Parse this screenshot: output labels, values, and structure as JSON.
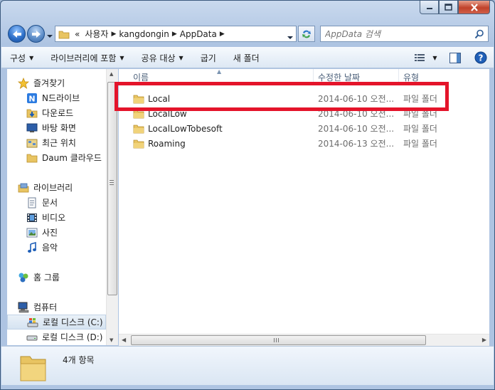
{
  "address": {
    "overflow": "«",
    "segments": [
      "사용자",
      "kangdongin",
      "AppData"
    ]
  },
  "search": {
    "placeholder": "AppData 검색"
  },
  "toolbar": {
    "organize": "구성",
    "include_library": "라이브러리에 포함",
    "share": "공유 대상",
    "burn": "굽기",
    "new_folder": "새 폴더"
  },
  "nav": {
    "favorites": "즐겨찾기",
    "fav_items": [
      "N드라이브",
      "다운로드",
      "바탕 화면",
      "최근 위치",
      "Daum 클라우드"
    ],
    "libraries": "라이브러리",
    "lib_items": [
      "문서",
      "비디오",
      "사진",
      "음악"
    ],
    "homegroup": "홈 그룹",
    "computer": "컴퓨터",
    "drives": [
      "로컬 디스크 (C:)",
      "로컬 디스크 (D:)"
    ]
  },
  "columns": {
    "name": "이름",
    "date": "수정한 날짜",
    "type": "유형"
  },
  "files": [
    {
      "name": "Local",
      "date": "2014-06-10 오전...",
      "type": "파일 폴더"
    },
    {
      "name": "LocalLow",
      "date": "2014-06-10 오전...",
      "type": "파일 폴더"
    },
    {
      "name": "LocalLowTobesoft",
      "date": "2014-06-10 오전...",
      "type": "파일 폴더"
    },
    {
      "name": "Roaming",
      "date": "2014-06-13 오전...",
      "type": "파일 폴더"
    }
  ],
  "status": {
    "count": "4개 항목"
  },
  "colors": {
    "highlight": "#e4142a",
    "folder": "#e8c462"
  },
  "icons": {
    "back": "arrow-left-icon",
    "forward": "arrow-right-icon",
    "refresh": "refresh-icon",
    "search": "magnifier-icon",
    "folder": "folder-icon",
    "star": "star-icon"
  }
}
